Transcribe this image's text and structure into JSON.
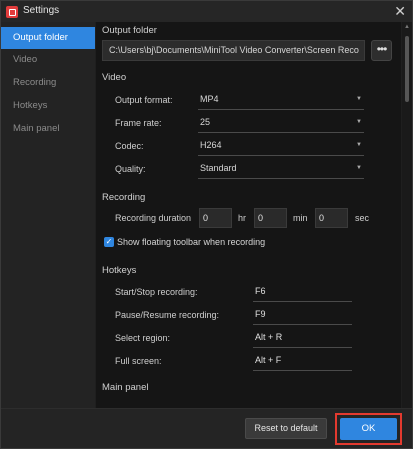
{
  "window": {
    "title": "Settings",
    "close_glyph": "✕"
  },
  "sidebar": {
    "items": [
      {
        "label": "Output folder",
        "active": true
      },
      {
        "label": "Video",
        "active": false
      },
      {
        "label": "Recording",
        "active": false
      },
      {
        "label": "Hotkeys",
        "active": false
      },
      {
        "label": "Main panel",
        "active": false
      }
    ]
  },
  "output_folder": {
    "title": "Output folder",
    "path": "C:\\Users\\bj\\Documents\\MiniTool Video Converter\\Screen Reco",
    "more_glyph": "•••"
  },
  "video": {
    "title": "Video",
    "output_format": {
      "label": "Output format:",
      "value": "MP4"
    },
    "frame_rate": {
      "label": "Frame rate:",
      "value": "25"
    },
    "codec": {
      "label": "Codec:",
      "value": "H264"
    },
    "quality": {
      "label": "Quality:",
      "value": "Standard"
    }
  },
  "recording": {
    "title": "Recording",
    "duration_label": "Recording duration",
    "hr_value": "0",
    "hr_unit": "hr",
    "min_value": "0",
    "min_unit": "min",
    "sec_value": "0",
    "sec_unit": "sec",
    "toolbar_checkbox": {
      "checked": true,
      "label": "Show floating toolbar when recording",
      "glyph": "✓"
    }
  },
  "hotkeys": {
    "title": "Hotkeys",
    "items": [
      {
        "label": "Start/Stop recording:",
        "value": "F6"
      },
      {
        "label": "Pause/Resume recording:",
        "value": "F9"
      },
      {
        "label": "Select region:",
        "value": "Alt + R"
      },
      {
        "label": "Full screen:",
        "value": "Alt + F"
      }
    ]
  },
  "main_panel": {
    "title": "Main panel"
  },
  "footer": {
    "reset_label": "Reset to default",
    "ok_label": "OK"
  },
  "colors": {
    "accent": "#2f86e0",
    "highlight": "#e33a2f",
    "app_icon": "#e23c3c"
  },
  "icons": {
    "dropdown": "▼",
    "scroll_up": "▲"
  }
}
